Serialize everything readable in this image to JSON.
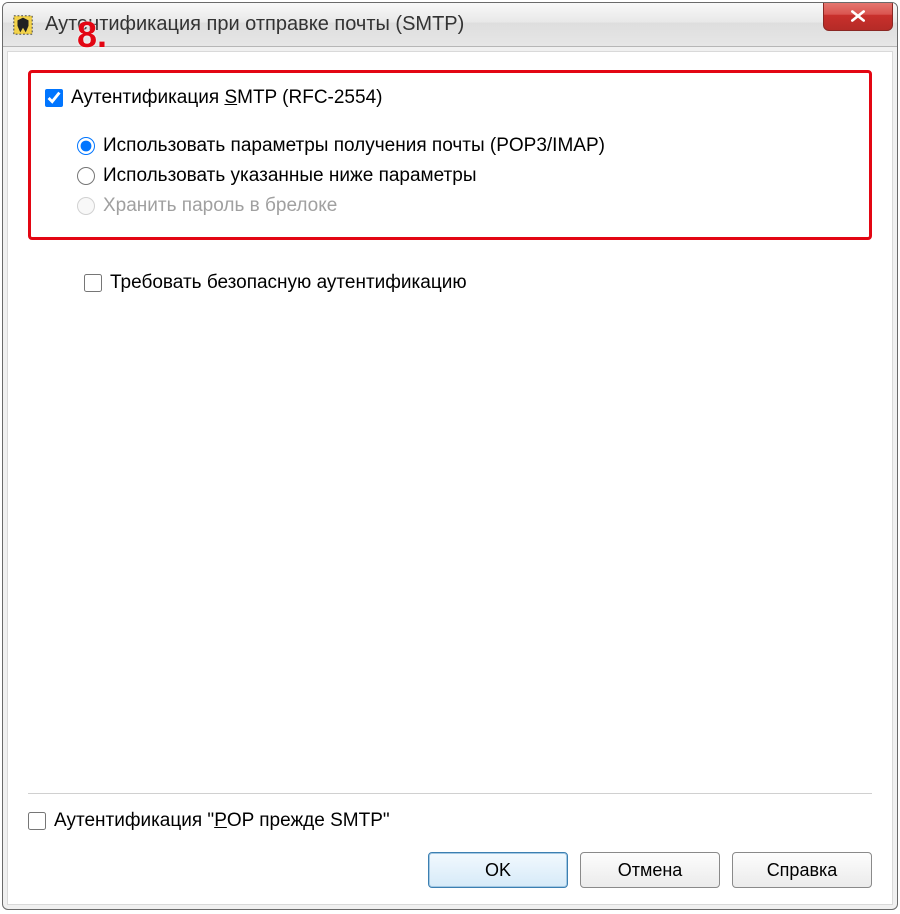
{
  "annotation": "8.",
  "window": {
    "title": "Аутентификация при отправке почты (SMTP)"
  },
  "smtp_auth": {
    "checkbox_label_prefix": "Аутентификация ",
    "checkbox_hotkey": "S",
    "checkbox_label_suffix": "MTP (RFC-2554)",
    "checked": true,
    "radios": {
      "use_pop_imap": "Использовать параметры получения почты (POP3/IMAP)",
      "use_below": "Использовать указанные ниже параметры",
      "keychain": "Хранить пароль в брелоке",
      "selected": "use_pop_imap",
      "keychain_enabled": false
    }
  },
  "require_secure_auth": {
    "label": "Требовать безопасную аутентификацию",
    "checked": false
  },
  "pop_before_smtp": {
    "label_prefix": "Аутентификация \"",
    "hotkey": "P",
    "label_suffix": "OP прежде SMTP\"",
    "checked": false
  },
  "buttons": {
    "ok": "OK",
    "cancel": "Отмена",
    "help": "Справка"
  }
}
